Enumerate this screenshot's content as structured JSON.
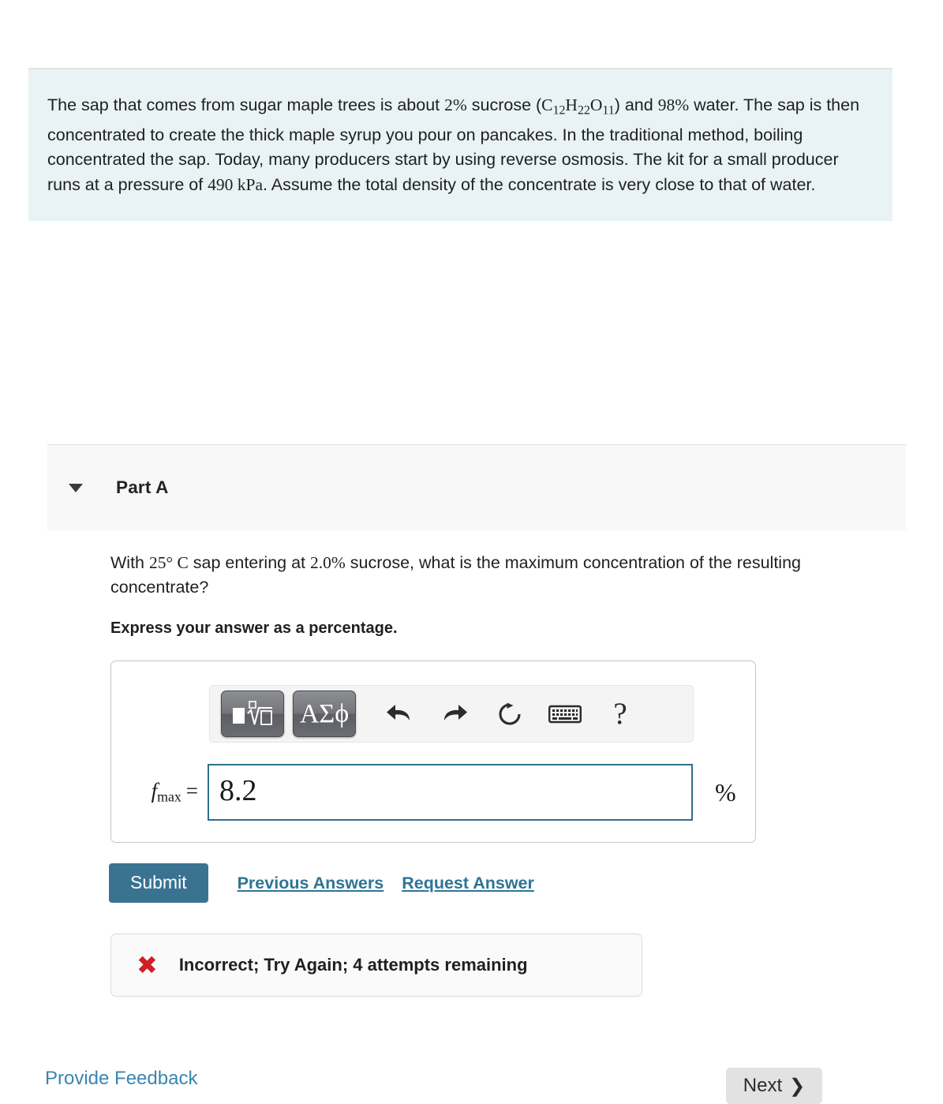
{
  "problem": {
    "text_parts": {
      "p1": "The sap that comes from sugar maple trees is about ",
      "pct2": "2%",
      "p2": " sucrose (",
      "formula_c": "C",
      "formula_c_sub": "12",
      "formula_h": "H",
      "formula_h_sub": "22",
      "formula_o": "O",
      "formula_o_sub": "11",
      "p3": ") and ",
      "pct98": "98%",
      "p4": " water. The sap is then concentrated to create the thick maple syrup you pour on pancakes. In the traditional method, boiling concentrated the sap. Today, many producers start by using reverse osmosis. The kit for a small producer runs at a pressure of ",
      "pressure": "490 kPa",
      "p5": ". Assume the total density of the concentrate is very close to that of water."
    },
    "background_color": "#e9f3f5"
  },
  "part": {
    "title": "Part A",
    "caret": "caret-down-icon",
    "question_parts": {
      "q1": "With ",
      "temp": "25° C",
      "q2": " sap entering at ",
      "conc": "2.0%",
      "q3": " sucrose, what is the maximum concentration of the resulting concentrate?"
    },
    "instruction": "Express your answer as a percentage."
  },
  "toolbar": {
    "template_button": "template-sqrt-icon",
    "greek_button": "ΑΣϕ",
    "undo": "undo-icon",
    "redo": "redo-icon",
    "reset": "reset-icon",
    "keyboard": "keyboard-icon",
    "help": "?"
  },
  "answer": {
    "variable": "f",
    "variable_sub": "max",
    "equals": "=",
    "value": "8.2",
    "placeholder": "",
    "unit": "%"
  },
  "actions": {
    "submit": "Submit",
    "previous_answers": "Previous Answers",
    "request_answer": "Request Answer",
    "submit_color": "#3a7392",
    "link_color": "#2e7496"
  },
  "feedback": {
    "icon": "✖",
    "icon_color": "#cf2027",
    "message": "Incorrect; Try Again; 4 attempts remaining"
  },
  "footer": {
    "provide_feedback": "Provide Feedback",
    "next": "Next",
    "next_chevron": "❯"
  }
}
